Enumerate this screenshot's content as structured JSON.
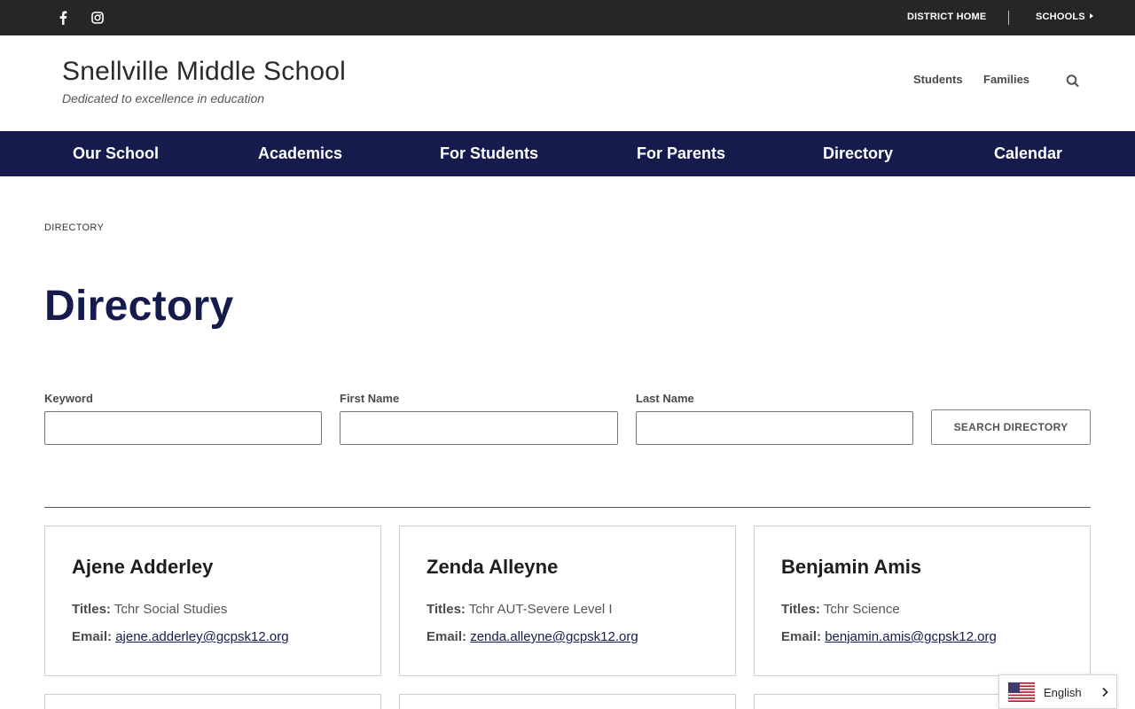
{
  "topbar": {
    "social": [
      "facebook-icon",
      "instagram-icon"
    ],
    "district_home": "DISTRICT HOME",
    "schools": "SCHOOLS"
  },
  "header": {
    "title": "Snellville Middle School",
    "tagline": "Dedicated to excellence in education",
    "links": [
      "Students",
      "Families"
    ],
    "search_icon": "search-icon"
  },
  "nav": {
    "items": [
      "Our School",
      "Academics",
      "For Students",
      "For Parents",
      "Directory",
      "Calendar"
    ]
  },
  "breadcrumb": "DIRECTORY",
  "page_title": "Directory",
  "form": {
    "keyword_label": "Keyword",
    "keyword_value": "",
    "first_name_label": "First Name",
    "first_name_value": "",
    "last_name_label": "Last Name",
    "last_name_value": "",
    "search_button": "SEARCH DIRECTORY"
  },
  "labels": {
    "titles": "Titles:",
    "email": "Email:"
  },
  "people": [
    {
      "name": "Ajene Adderley",
      "title": "Tchr Social Studies",
      "email": "ajene.adderley@gcpsk12.org"
    },
    {
      "name": "Zenda Alleyne",
      "title": "Tchr AUT-Severe Level I",
      "email": "zenda.alleyne@gcpsk12.org"
    },
    {
      "name": "Benjamin Amis",
      "title": "Tchr Science",
      "email": "benjamin.amis@gcpsk12.org"
    }
  ],
  "language": {
    "label": "English",
    "flag_icon": "us-flag-icon"
  },
  "colors": {
    "navy": "#161b4d",
    "topbar": "#262626"
  }
}
